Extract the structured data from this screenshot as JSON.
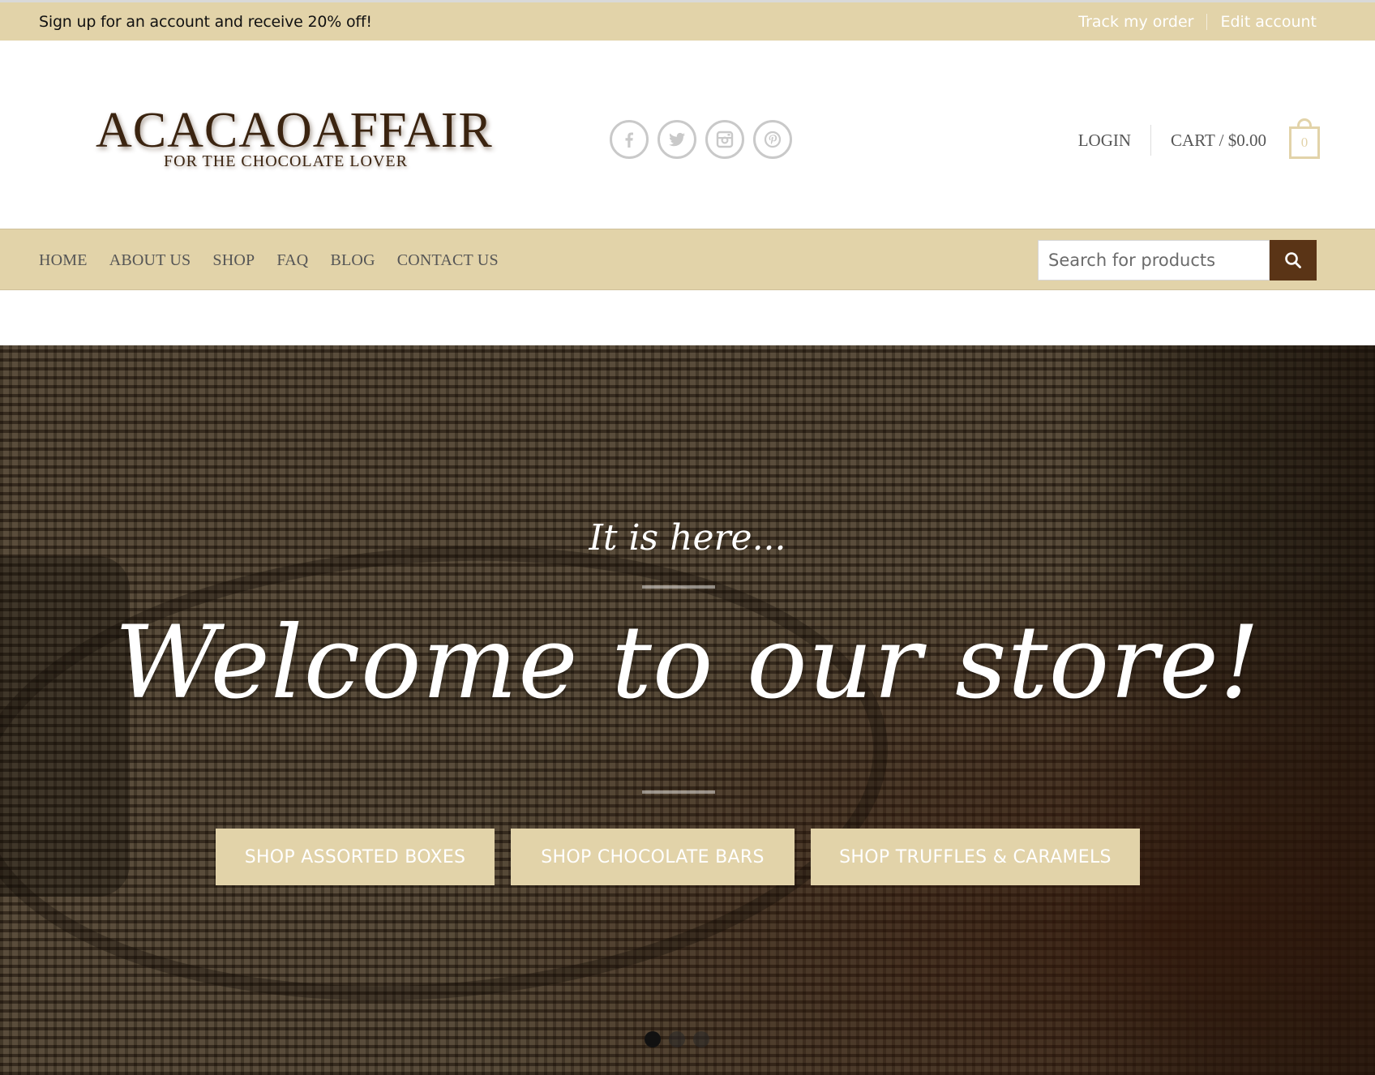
{
  "topbar": {
    "promo": "Sign up for an account and receive 20% off!",
    "track_order": "Track my order",
    "edit_account": "Edit account"
  },
  "logo": {
    "wordmark": "ACACAOAFFAIR",
    "tagline": "FOR THE CHOCOLATE LOVER"
  },
  "social": [
    "facebook-icon",
    "twitter-icon",
    "instagram-icon",
    "pinterest-icon"
  ],
  "account": {
    "login": "LOGIN",
    "cart_label": "CART /",
    "cart_total": "$0.00",
    "cart_count": "0"
  },
  "nav": {
    "items": [
      "HOME",
      "ABOUT US",
      "SHOP",
      "FAQ",
      "BLOG",
      "CONTACT US"
    ],
    "search_placeholder": "Search for products"
  },
  "hero": {
    "subtitle": "It is here...",
    "title": "Welcome to our store!",
    "buttons": [
      "SHOP ASSORTED BOXES",
      "SHOP CHOCOLATE BARS",
      "SHOP TRUFFLES & CARAMELS"
    ],
    "slides": 3,
    "active_slide": 1
  },
  "colors": {
    "accent": "#e2d3a9",
    "brown": "#5a3416"
  }
}
